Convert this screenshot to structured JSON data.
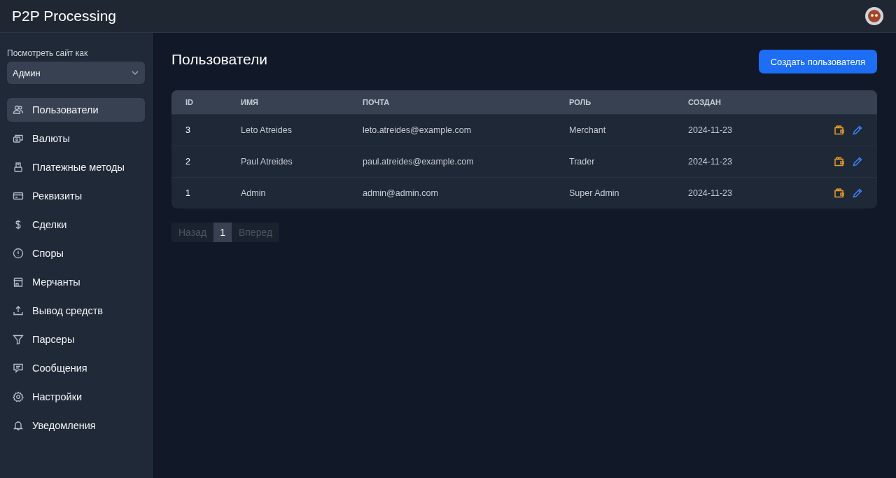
{
  "app": {
    "title": "P2P Processing"
  },
  "sidebar": {
    "view_as_label": "Посмотреть сайт как",
    "view_as_value": "Админ",
    "items": [
      {
        "label": "Пользователи",
        "selected": true
      },
      {
        "label": "Валюты",
        "selected": false
      },
      {
        "label": "Платежные методы",
        "selected": false
      },
      {
        "label": "Реквизиты",
        "selected": false
      },
      {
        "label": "Сделки",
        "selected": false
      },
      {
        "label": "Споры",
        "selected": false
      },
      {
        "label": "Мерчанты",
        "selected": false
      },
      {
        "label": "Вывод средств",
        "selected": false
      },
      {
        "label": "Парсеры",
        "selected": false
      },
      {
        "label": "Сообщения",
        "selected": false
      },
      {
        "label": "Настройки",
        "selected": false
      },
      {
        "label": "Уведомления",
        "selected": false
      }
    ]
  },
  "page": {
    "title": "Пользователи",
    "create_button": "Создать пользователя"
  },
  "table": {
    "columns": [
      "ID",
      "ИМЯ",
      "ПОЧТА",
      "РОЛЬ",
      "СОЗДАН"
    ],
    "rows": [
      {
        "id": "3",
        "name": "Leto Atreides",
        "email": "leto.atreides@example.com",
        "role": "Merchant",
        "created": "2024-11-23"
      },
      {
        "id": "2",
        "name": "Paul Atreides",
        "email": "paul.atreides@example.com",
        "role": "Trader",
        "created": "2024-11-23"
      },
      {
        "id": "1",
        "name": "Admin",
        "email": "admin@admin.com",
        "role": "Super Admin",
        "created": "2024-11-23"
      }
    ]
  },
  "pagination": {
    "prev": {
      "label": "Назад",
      "disabled": true
    },
    "pages": [
      {
        "label": "1",
        "selected": true
      }
    ],
    "next": {
      "label": "Вперед",
      "disabled": true
    }
  }
}
